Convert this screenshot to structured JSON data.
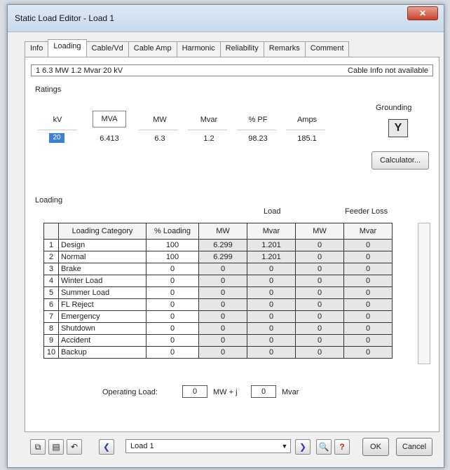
{
  "window": {
    "title": "Static Load Editor - Load 1",
    "close_glyph": "✕"
  },
  "tabs": [
    "Info",
    "Loading",
    "Cable/Vd",
    "Cable Amp",
    "Harmonic",
    "Reliability",
    "Remarks",
    "Comment"
  ],
  "info_bar": {
    "left": "1  6.3 MW  1.2 Mvar  20 kV",
    "right": "Cable Info not available"
  },
  "ratings": {
    "section_label": "Ratings",
    "headers": {
      "kv": "kV",
      "mva": "MVA",
      "mw": "MW",
      "mvar": "Mvar",
      "pf": "% PF",
      "amps": "Amps"
    },
    "values": {
      "kv": "20",
      "mva": "6.413",
      "mw": "6.3",
      "mvar": "1.2",
      "pf": "98.23",
      "amps": "185.1"
    }
  },
  "grounding": {
    "label": "Grounding",
    "button_glyph": "Y",
    "calculator_label": "Calculator..."
  },
  "loading": {
    "section_label": "Loading",
    "group_load": "Load",
    "group_feeder_loss": "Feeder Loss",
    "columns": [
      "Loading Category",
      "% Loading",
      "MW",
      "Mvar",
      "MW",
      "Mvar"
    ],
    "rows": [
      {
        "no": "1",
        "category": "Design",
        "pct": "100",
        "mw": "6.299",
        "mvar": "1.201",
        "fl_mw": "0",
        "fl_mvar": "0"
      },
      {
        "no": "2",
        "category": "Normal",
        "pct": "100",
        "mw": "6.299",
        "mvar": "1.201",
        "fl_mw": "0",
        "fl_mvar": "0"
      },
      {
        "no": "3",
        "category": "Brake",
        "pct": "0",
        "mw": "0",
        "mvar": "0",
        "fl_mw": "0",
        "fl_mvar": "0"
      },
      {
        "no": "4",
        "category": "Winter Load",
        "pct": "0",
        "mw": "0",
        "mvar": "0",
        "fl_mw": "0",
        "fl_mvar": "0"
      },
      {
        "no": "5",
        "category": "Summer Load",
        "pct": "0",
        "mw": "0",
        "mvar": "0",
        "fl_mw": "0",
        "fl_mvar": "0"
      },
      {
        "no": "6",
        "category": "FL Reject",
        "pct": "0",
        "mw": "0",
        "mvar": "0",
        "fl_mw": "0",
        "fl_mvar": "0"
      },
      {
        "no": "7",
        "category": "Emergency",
        "pct": "0",
        "mw": "0",
        "mvar": "0",
        "fl_mw": "0",
        "fl_mvar": "0"
      },
      {
        "no": "8",
        "category": "Shutdown",
        "pct": "0",
        "mw": "0",
        "mvar": "0",
        "fl_mw": "0",
        "fl_mvar": "0"
      },
      {
        "no": "9",
        "category": "Accident",
        "pct": "0",
        "mw": "0",
        "mvar": "0",
        "fl_mw": "0",
        "fl_mvar": "0"
      },
      {
        "no": "10",
        "category": "Backup",
        "pct": "0",
        "mw": "0",
        "mvar": "0",
        "fl_mw": "0",
        "fl_mvar": "0"
      }
    ]
  },
  "operating_load": {
    "label": "Operating Load:",
    "mw_value": "0",
    "mw_unit": "MW + j",
    "mvar_value": "0",
    "mvar_unit": "Mvar"
  },
  "footer": {
    "load_select": "Load 1",
    "help_glyph": "?",
    "find_glyph": "🔍",
    "ok_label": "OK",
    "cancel_label": "Cancel"
  }
}
